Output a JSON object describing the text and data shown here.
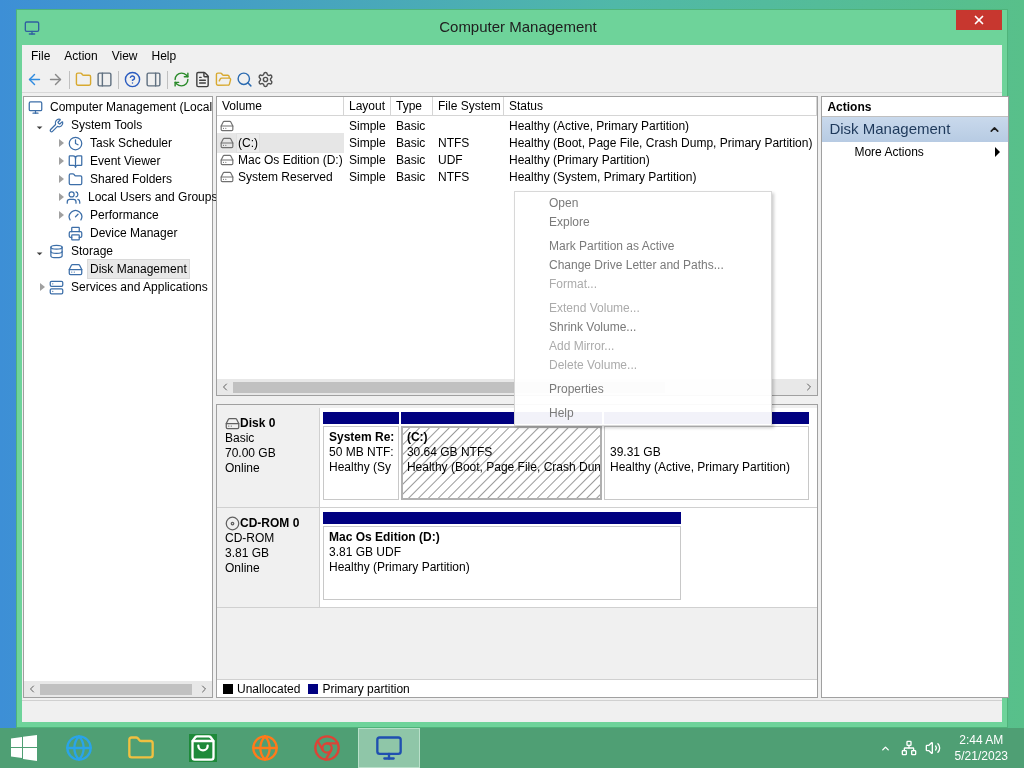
{
  "window": {
    "title": "Computer Management"
  },
  "menu_bar": [
    "File",
    "Action",
    "View",
    "Help"
  ],
  "tree": [
    {
      "label": "Computer Management (Local",
      "selected": false,
      "children": [
        {
          "label": "System Tools",
          "expanded": true,
          "selected": false,
          "children": [
            {
              "label": "Task Scheduler",
              "expanded": false,
              "selected": false
            },
            {
              "label": "Event Viewer",
              "expanded": false,
              "selected": false
            },
            {
              "label": "Shared Folders",
              "expanded": false,
              "selected": false
            },
            {
              "label": "Local Users and Groups",
              "expanded": false,
              "selected": false
            },
            {
              "label": "Performance",
              "expanded": false,
              "selected": false
            },
            {
              "label": "Device Manager",
              "selected": false
            }
          ]
        },
        {
          "label": "Storage",
          "expanded": true,
          "selected": false,
          "children": [
            {
              "label": "Disk Management",
              "selected": true
            }
          ]
        },
        {
          "label": "Services and Applications",
          "expanded": false,
          "selected": false
        }
      ]
    }
  ],
  "volume_table": {
    "columns": [
      "Volume",
      "Layout",
      "Type",
      "File System",
      "Status"
    ],
    "rows": [
      {
        "layout": "Simple",
        "type": "Basic",
        "status": "Healthy (Active, Primary Partition)",
        "selected": false
      },
      {
        "volume": "(C:)",
        "layout": "Simple",
        "type": "Basic",
        "file_system": "NTFS",
        "status": "Healthy (Boot, Page File, Crash Dump, Primary Partition)",
        "selected": true
      },
      {
        "volume": "Mac Os Edition (D:)",
        "layout": "Simple",
        "type": "Basic",
        "file_system": "UDF",
        "status": "Healthy (Primary Partition)",
        "selected": false
      },
      {
        "volume": "System Reserved",
        "layout": "Simple",
        "type": "Basic",
        "file_system": "NTFS",
        "status": "Healthy (System, Primary Partition)",
        "selected": false
      }
    ]
  },
  "disks": [
    {
      "name": "Disk 0",
      "type": "Basic",
      "size": "70.00 GB",
      "status": "Online",
      "partitions": [
        {
          "title": "System Re:",
          "size": "50 MB NTF:",
          "status": "Healthy (Sy",
          "selected": false
        },
        {
          "title": "(C:)",
          "size": "30.64 GB NTFS",
          "status": "Healthy (Boot, Page File, Crash Dun",
          "selected": true
        },
        {
          "size": "39.31 GB",
          "status": "Healthy (Active, Primary Partition)",
          "selected": false
        }
      ]
    },
    {
      "name": "CD-ROM 0",
      "type": "CD-ROM",
      "size": "3.81 GB",
      "status": "Online",
      "partitions": [
        {
          "title": "Mac Os Edition  (D:)",
          "size": "3.81 GB UDF",
          "status": "Healthy (Primary Partition)",
          "selected": false
        }
      ]
    }
  ],
  "legend": [
    {
      "label": "Unallocated",
      "color": "#000000"
    },
    {
      "label": "Primary partition",
      "color": "#000080"
    }
  ],
  "actions": {
    "header": "Actions",
    "section": {
      "title": "Disk Management",
      "expanded": true
    },
    "items": [
      "More Actions"
    ]
  },
  "context_menu": {
    "groups": [
      [
        {
          "label": "Open",
          "disabled": false
        },
        {
          "label": "Explore",
          "disabled": false
        }
      ],
      [
        {
          "label": "Mark Partition as Active",
          "disabled": false
        },
        {
          "label": "Change Drive Letter and Paths...",
          "disabled": false
        },
        {
          "label": "Format...",
          "disabled": true
        }
      ],
      [
        {
          "label": "Extend Volume...",
          "disabled": true
        },
        {
          "label": "Shrink Volume...",
          "disabled": false
        },
        {
          "label": "Add Mirror...",
          "disabled": true
        },
        {
          "label": "Delete Volume...",
          "disabled": true
        }
      ],
      [
        {
          "label": "Properties",
          "disabled": false
        }
      ],
      [
        {
          "label": "Help",
          "disabled": false
        }
      ]
    ]
  },
  "taskbar": {
    "apps": [
      {
        "selected": false
      },
      {
        "selected": false
      },
      {
        "selected": false
      },
      {
        "selected": false
      },
      {
        "selected": false
      },
      {
        "selected": true
      }
    ],
    "time": "2:44 AM",
    "date": "5/21/2023"
  }
}
